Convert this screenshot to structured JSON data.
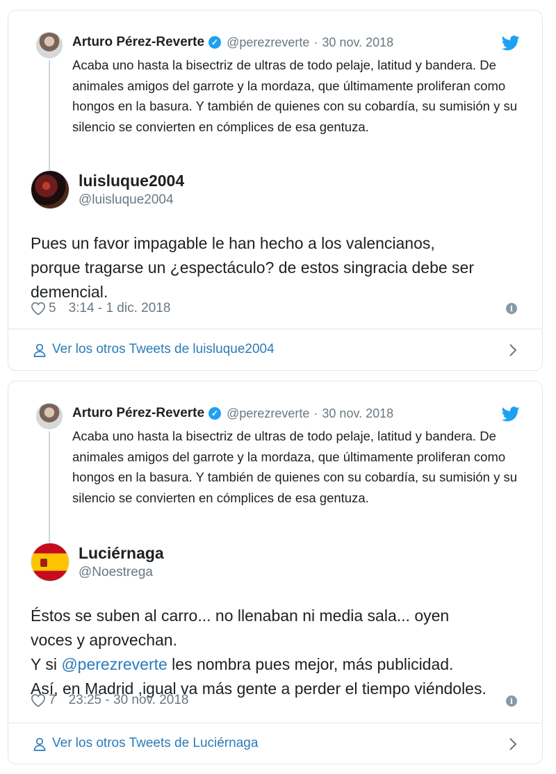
{
  "cards": [
    {
      "parent": {
        "name": "Arturo Pérez-Reverte",
        "handle": "@perezreverte",
        "separator": "·",
        "date": "30 nov. 2018",
        "text": "Acaba uno hasta la bisectriz de ultras de todo pelaje, latitud y bandera. De animales amigos del garrote y la mordaza, que últimamente proliferan como hongos en la basura. Y también de quienes con su cobardía, su sumisión y su silencio se convierten en cómplices de esa gentuza.",
        "verified_icon": "verified-badge-icon"
      },
      "reply": {
        "name": "luisluque2004",
        "handle": "@luisluque2004",
        "avatar": "photo-avatar",
        "text_lines": [
          "Pues un favor impagable le han hecho a los valencianos,",
          "porque tragarse un ¿espectáculo? de estos singracia debe ser",
          "demencial."
        ],
        "likes": "5",
        "timestamp": "3:14 - 1 dic. 2018"
      },
      "footer": {
        "label": "Ver los otros Tweets de luisluque2004"
      }
    },
    {
      "parent": {
        "name": "Arturo Pérez-Reverte",
        "handle": "@perezreverte",
        "separator": "·",
        "date": "30 nov. 2018",
        "text": "Acaba uno hasta la bisectriz de ultras de todo pelaje, latitud y bandera. De animales amigos del garrote y la mordaza, que últimamente proliferan como hongos en la basura. Y también de quienes con su cobardía, su sumisión y su silencio se convierten en cómplices de esa gentuza.",
        "verified_icon": "verified-badge-icon"
      },
      "reply": {
        "name": "Luciérnaga",
        "handle": "@Noestrega",
        "avatar": "spain-flag-avatar",
        "text_line1": "Éstos  se suben al carro... no llenaban ni media sala... oyen",
        "text_line2": "voces y aprovechan.",
        "text_line3_prefix": "Y si ",
        "text_line3_mention": "@perezreverte",
        "text_line3_suffix": " les nombra pues mejor, más publicidad.",
        "text_line4": "Así, en Madrid ,igual va más gente a perder el tiempo viéndoles.",
        "likes": "7",
        "timestamp": "23:25 - 30 nov. 2018"
      },
      "footer": {
        "label": "Ver los otros Tweets de Luciérnaga"
      }
    }
  ],
  "colors": {
    "twitter_blue": "#1da1f2",
    "link": "#2b7bb9",
    "muted": "#697882",
    "border": "#e1e8ed"
  },
  "icons": [
    "twitter-bird-icon",
    "verified-badge-icon",
    "heart-icon",
    "info-icon",
    "person-icon",
    "chevron-right-icon"
  ]
}
